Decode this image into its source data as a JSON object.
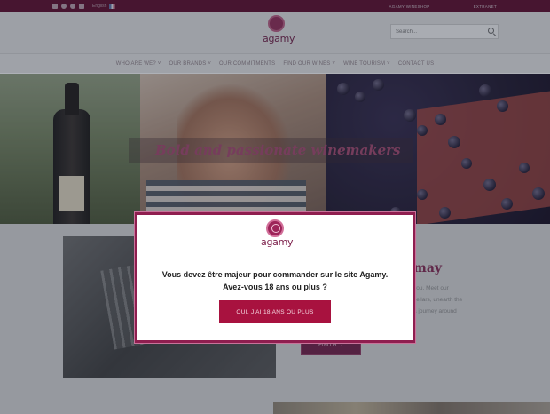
{
  "topbar": {
    "social_icons": [
      "facebook-icon",
      "instagram-icon",
      "pinterest-icon",
      "linkedin-icon"
    ],
    "language": "English",
    "links": [
      "AGAMY WINESHOP",
      "EXTRANET"
    ]
  },
  "header": {
    "logo_text": "agamy",
    "search_placeholder": "Search..."
  },
  "nav": {
    "items": [
      {
        "label": "WHO ARE WE? ˅"
      },
      {
        "label": "OUR BRANDS ˅"
      },
      {
        "label": "OUR COMMITMENTS"
      },
      {
        "label": "FIND OUR WINES ˅"
      },
      {
        "label": "WINE TOURISM ˅"
      },
      {
        "label": "CONTACT US"
      }
    ]
  },
  "hero": {
    "tagline": "Bold and passionate winemakers"
  },
  "section": {
    "heading_fragment": "may",
    "text_fragments": [
      "you. Meet our",
      "cellars, unearth the",
      "a journey around"
    ],
    "button_label": "FIND H  →"
  },
  "modal": {
    "logo_text": "agamy",
    "line1": "Vous devez être majeur pour commander sur le site Agamy.",
    "line2": "Avez-vous 18 ans ou plus ?",
    "button_label": "OUI, J'AI 18 ANS OU PLUS"
  },
  "colors": {
    "brand": "#8f1e4f",
    "button": "#a8123f",
    "topbar": "#5a0d2c"
  }
}
